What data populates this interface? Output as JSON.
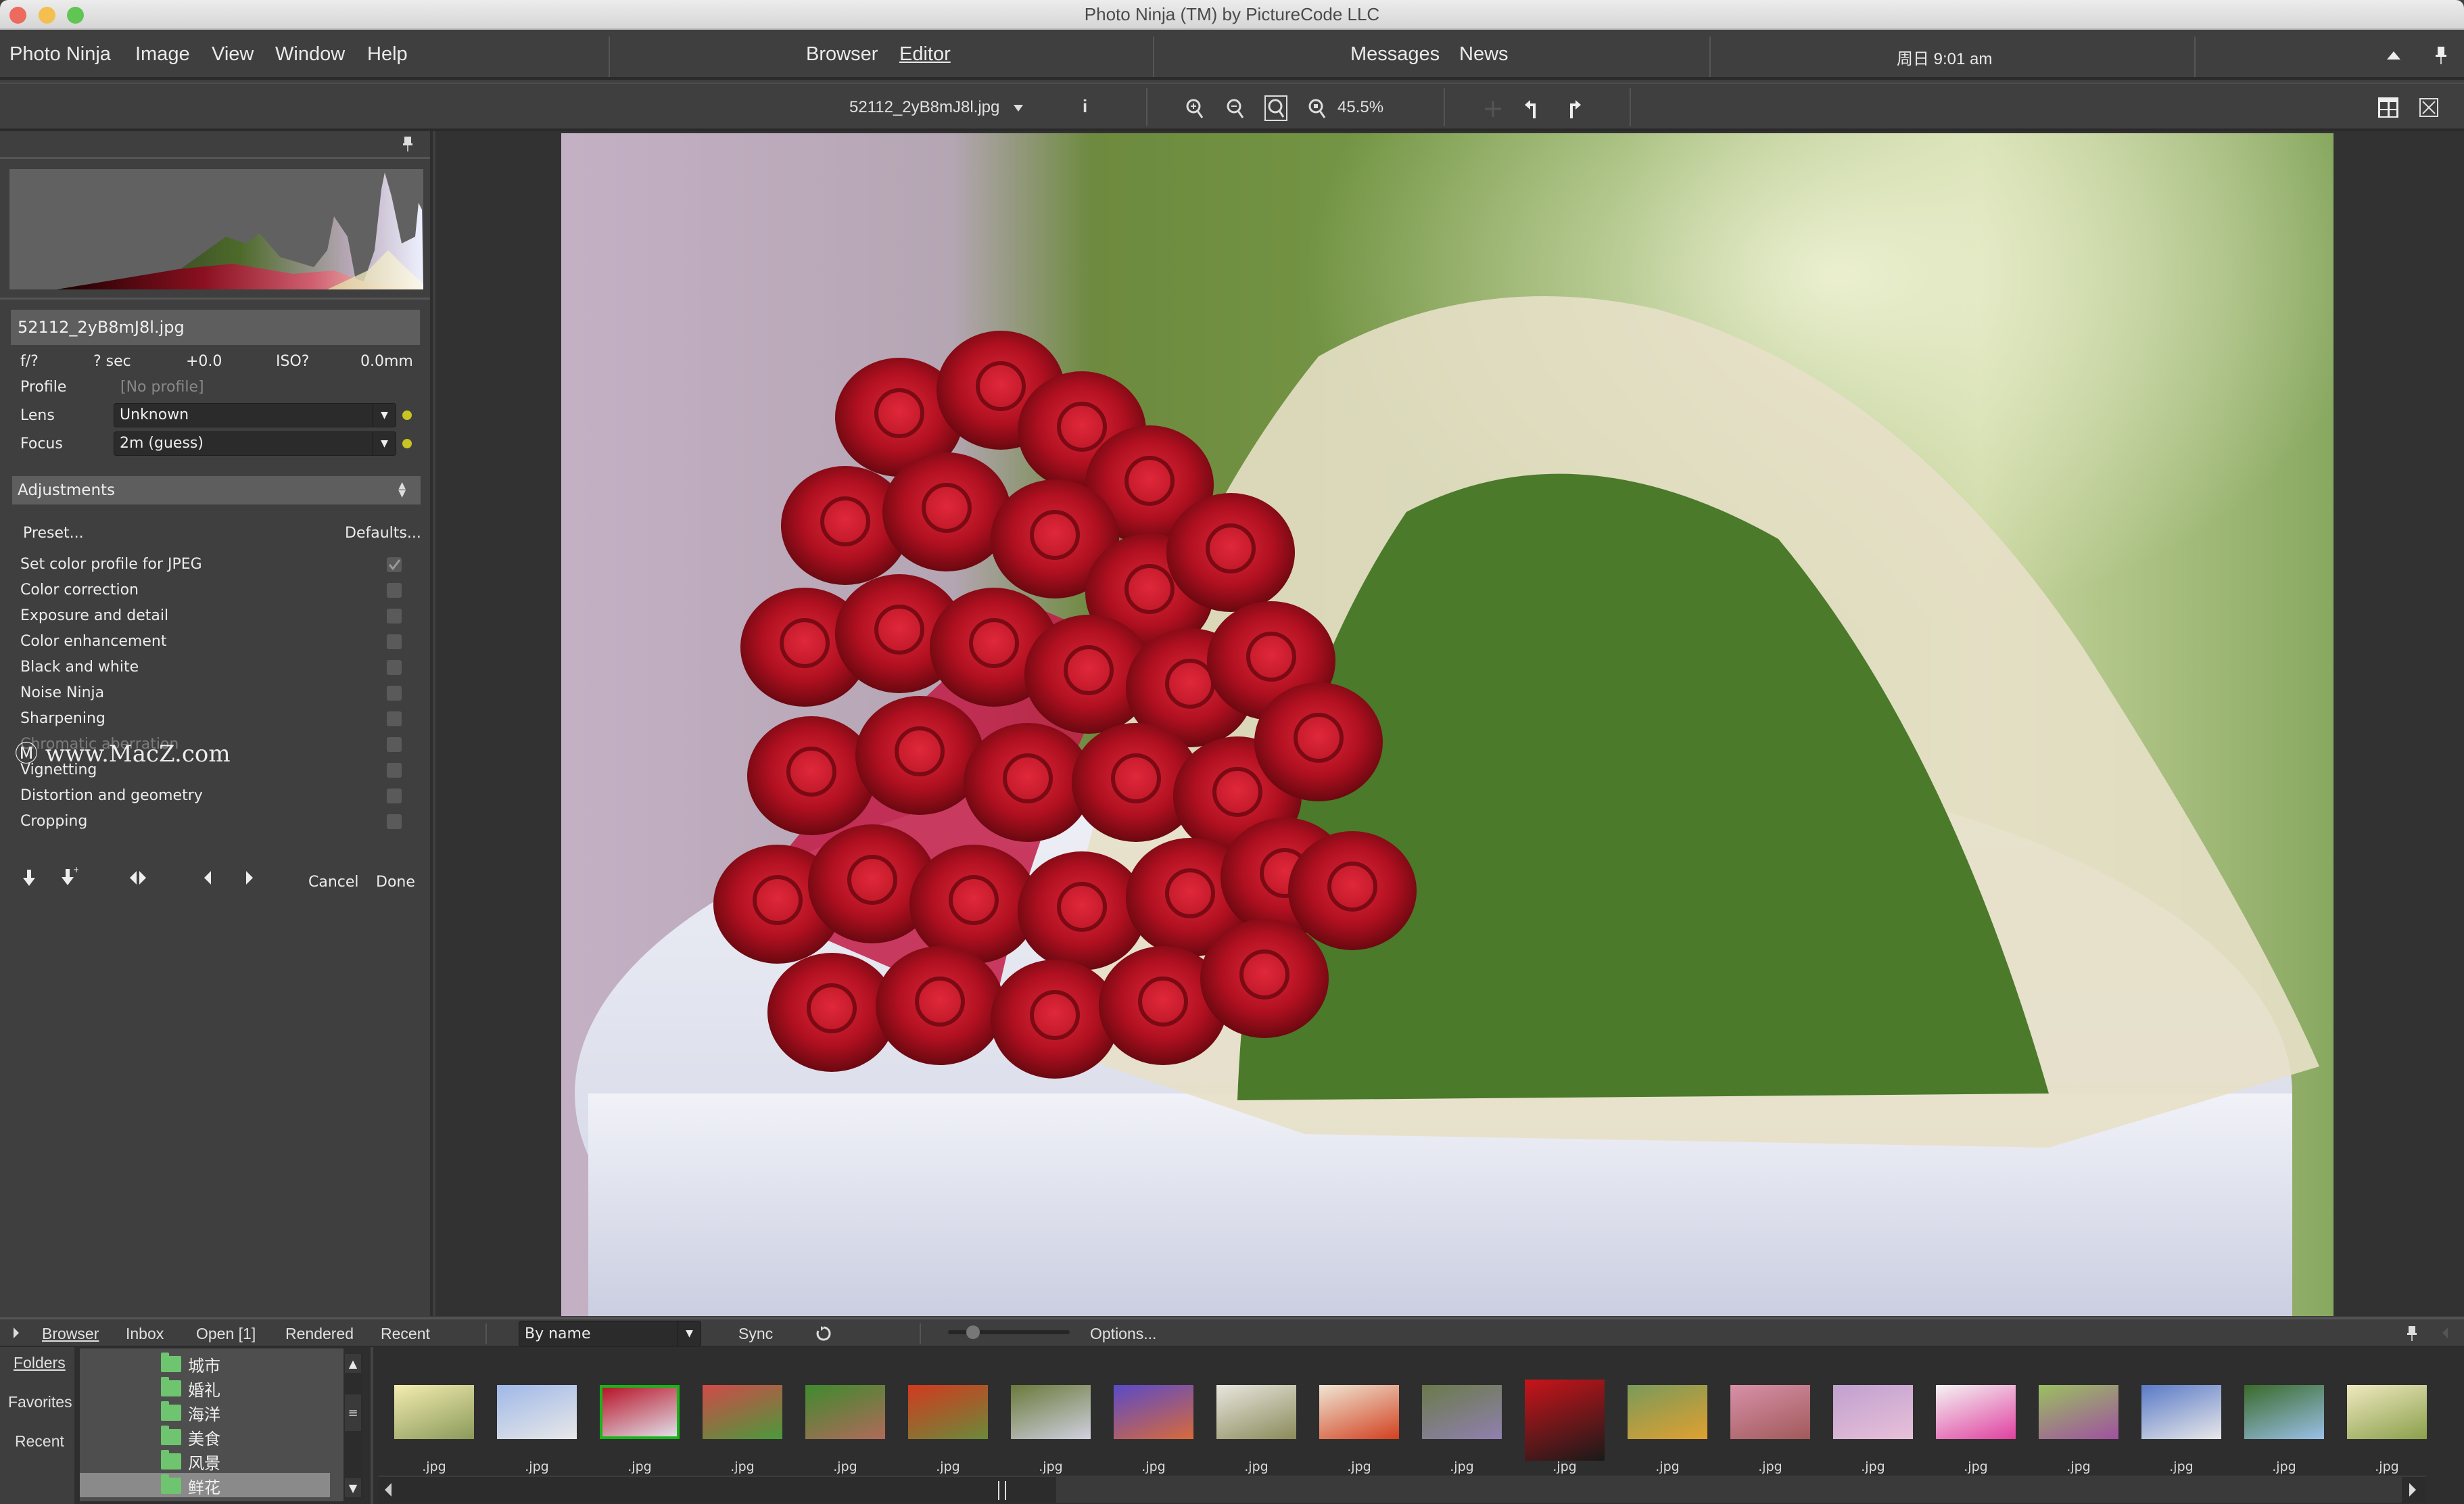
{
  "window": {
    "title": "Photo Ninja (TM) by PictureCode LLC",
    "traffic_lights": {
      "close": "#ec6a5e",
      "minimize": "#f4bf4f",
      "zoom": "#61c554"
    }
  },
  "menubar": {
    "menus": [
      "Photo Ninja",
      "Image",
      "View",
      "Window",
      "Help"
    ],
    "modes": [
      "Browser",
      "Editor"
    ],
    "active_mode": "Editor",
    "messages_label": "Messages",
    "news_label": "News",
    "clock": "周日 9:01 am",
    "collapse_icon": "triangle-up-icon",
    "pin_icon": "pin-icon"
  },
  "toolbar": {
    "filename": "52112_2yB8mJ8l.jpg",
    "info_label": "i",
    "zoom_level": "45.5%",
    "icons": [
      "zoom-in-icon",
      "zoom-out-icon",
      "zoom-fit-icon",
      "zoom-actual-icon",
      "move-icon",
      "undo-icon",
      "redo-icon",
      "layout-grid-icon",
      "close-view-icon"
    ]
  },
  "left_panel": {
    "filename": "52112_2yB8mJ8l.jpg",
    "exif": {
      "aperture": "f/?",
      "shutter": "? sec",
      "exposure_comp": "+0.0",
      "iso": "ISO?",
      "focal_length": "0.0mm"
    },
    "profile_label": "Profile",
    "profile_value": "[No profile]",
    "lens_label": "Lens",
    "lens_value": "Unknown",
    "focus_label": "Focus",
    "focus_value": "2m (guess)",
    "status_dot_color": "#c9c421",
    "adjustments_header": "Adjustments",
    "preset_label": "Preset...",
    "defaults_label": "Defaults...",
    "adjustments": [
      {
        "label": "Set color profile for JPEG",
        "checked": true
      },
      {
        "label": "Color correction",
        "checked": false
      },
      {
        "label": "Exposure and detail",
        "checked": false
      },
      {
        "label": "Color enhancement",
        "checked": false
      },
      {
        "label": "Black and white",
        "checked": false
      },
      {
        "label": "Noise Ninja",
        "checked": false
      },
      {
        "label": "Sharpening",
        "checked": false
      },
      {
        "label": "Chromatic aberration",
        "checked": false
      },
      {
        "label": "Vignetting",
        "checked": false
      },
      {
        "label": "Distortion and geometry",
        "checked": false
      },
      {
        "label": "Cropping",
        "checked": false
      }
    ],
    "watermark": "www.MacZ.com",
    "cancel_label": "Cancel",
    "done_label": "Done"
  },
  "browser_strip": {
    "tabs": [
      "Browser",
      "Inbox",
      "Open [1]",
      "Rendered",
      "Recent"
    ],
    "active_tab": "Browser",
    "sort_value": "By name",
    "sync_label": "Sync",
    "thumb_size": 0.15,
    "options_label": "Options..."
  },
  "folders_panel": {
    "sources": [
      "Folders",
      "Favorites",
      "Recent"
    ],
    "active_source": "Folders",
    "folders": [
      "城市",
      "婚礼",
      "海洋",
      "美食",
      "风景",
      "鲜花"
    ],
    "selected_folder": "鲜花"
  },
  "filmstrip": {
    "items": [
      {
        "label": ".jpg",
        "colors": [
          "#f3ecb0",
          "#8a9a5a"
        ]
      },
      {
        "label": ".jpg",
        "colors": [
          "#9fb8e8",
          "#e8e8e8"
        ]
      },
      {
        "label": ".jpg",
        "colors": [
          "#b8152a",
          "#e0dfe8"
        ],
        "selected": true
      },
      {
        "label": ".jpg",
        "colors": [
          "#d04a4a",
          "#4a9a3a"
        ]
      },
      {
        "label": ".jpg",
        "colors": [
          "#3f8a2e",
          "#b06a5a"
        ]
      },
      {
        "label": ".jpg",
        "colors": [
          "#d23a1f",
          "#6a8a3a"
        ]
      },
      {
        "label": ".jpg",
        "colors": [
          "#6a7a3a",
          "#d0d0e0"
        ]
      },
      {
        "label": ".jpg",
        "colors": [
          "#5a4ac8",
          "#d86a3a"
        ]
      },
      {
        "label": ".jpg",
        "colors": [
          "#e8e6de",
          "#8a8a5a"
        ]
      },
      {
        "label": ".jpg",
        "colors": [
          "#efe6d4",
          "#d2401f"
        ]
      },
      {
        "label": ".jpg",
        "colors": [
          "#6a7a4a",
          "#9080b0"
        ]
      },
      {
        "label": ".jpg",
        "colors": [
          "#c8141a",
          "#1a1a1a"
        ]
      },
      {
        "label": ".jpg",
        "colors": [
          "#7a9a5a",
          "#e0a030"
        ]
      },
      {
        "label": ".jpg",
        "colors": [
          "#d890a8",
          "#a05a5a"
        ]
      },
      {
        "label": ".jpg",
        "colors": [
          "#c0a0d0",
          "#e8c0d8"
        ]
      },
      {
        "label": ".jpg",
        "colors": [
          "#f4f4f4",
          "#e040a0"
        ]
      },
      {
        "label": ".jpg",
        "colors": [
          "#9ac060",
          "#a050a0"
        ]
      },
      {
        "label": ".jpg",
        "colors": [
          "#5a7ac8",
          "#e8e8e8"
        ]
      },
      {
        "label": ".jpg",
        "colors": [
          "#3a6a2a",
          "#9ac0e8"
        ]
      },
      {
        "label": ".jpg",
        "colors": [
          "#efe8c0",
          "#8aa04a"
        ]
      }
    ]
  }
}
